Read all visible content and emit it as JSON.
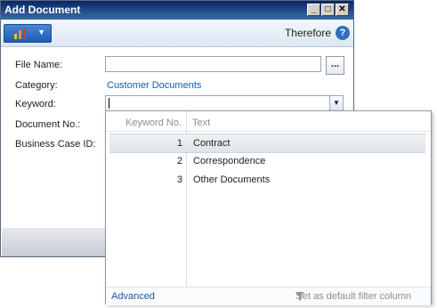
{
  "window": {
    "title": "Add Document",
    "buttons": {
      "minimize": "_",
      "maximize": "□",
      "close": "✕"
    }
  },
  "ribbon": {
    "company": "Therefore",
    "help": "?"
  },
  "form": {
    "file_name_label": "File Name:",
    "file_name_value": "",
    "browse_label": "...",
    "category_label": "Category:",
    "category_value": "Customer Documents",
    "keyword_label": "Keyword:",
    "keyword_value": "",
    "document_no_label": "Document No.:",
    "business_case_label": "Business Case ID:"
  },
  "dropdown": {
    "col_keyword_no": "Keyword No.",
    "col_text": "Text",
    "rows": [
      {
        "no": "1",
        "text": "Contract"
      },
      {
        "no": "2",
        "text": "Correspondence"
      },
      {
        "no": "3",
        "text": "Other Documents"
      }
    ],
    "selected_row": 0,
    "advanced_label": "Advanced",
    "set_default_label": "Set as default filter column"
  },
  "colors": {
    "title_bar": "#0a246a",
    "link": "#1c5aa6",
    "help": "#2f6fc0"
  },
  "icons": [
    "application-menu-icon",
    "help-icon",
    "chevron-down-icon",
    "filter-icon"
  ]
}
